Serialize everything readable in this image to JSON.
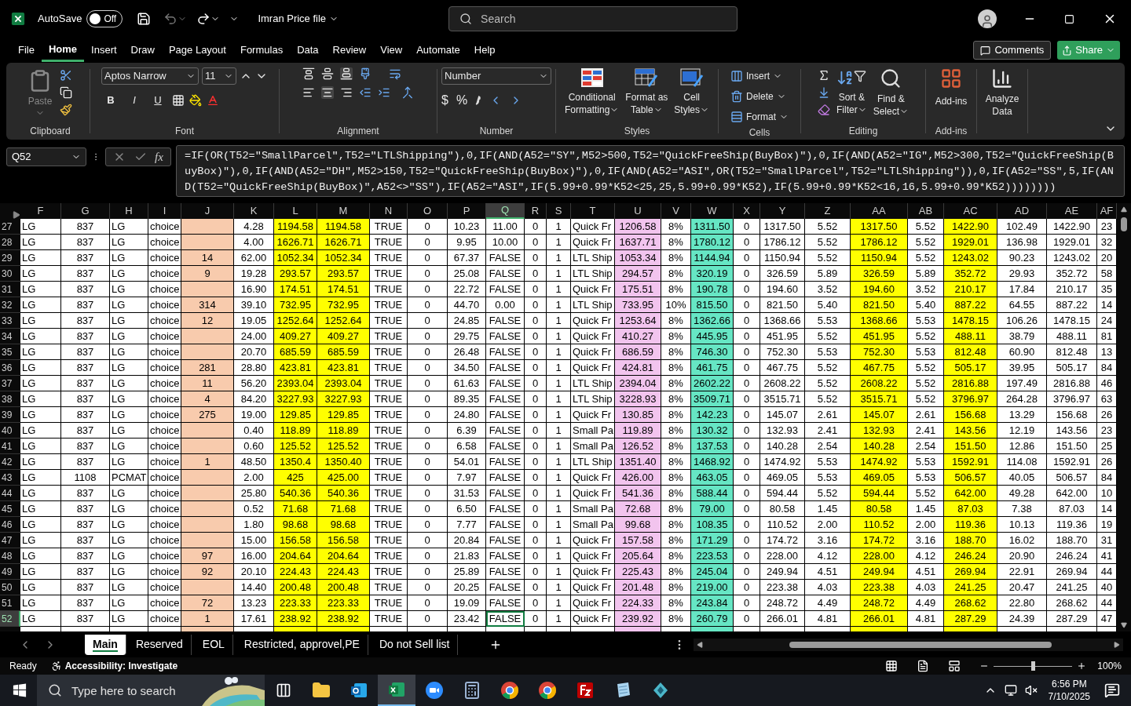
{
  "title_bar": {
    "autosave_label": "AutoSave",
    "autosave": {
      "label": "Off",
      "on": false
    },
    "file_name": "Imran Price file",
    "search": {
      "placeholder": "Search"
    }
  },
  "menu_tabs": [
    {
      "label": "File",
      "selected": false
    },
    {
      "label": "Home",
      "selected": true
    },
    {
      "label": "Insert",
      "selected": false
    },
    {
      "label": "Draw",
      "selected": false
    },
    {
      "label": "Page Layout",
      "selected": false
    },
    {
      "label": "Formulas",
      "selected": false
    },
    {
      "label": "Data",
      "selected": false
    },
    {
      "label": "Review",
      "selected": false
    },
    {
      "label": "View",
      "selected": false
    },
    {
      "label": "Automate",
      "selected": false
    },
    {
      "label": "Help",
      "selected": false
    }
  ],
  "comments_button": "Comments",
  "share_button": "Share",
  "ribbon": {
    "clipboard": {
      "label": "Clipboard",
      "paste": "Paste"
    },
    "font": {
      "label": "Font",
      "font_name": "Aptos Narrow",
      "font_size": "11",
      "bold": "B",
      "italic": "I",
      "underline": "U"
    },
    "alignment": {
      "label": "Alignment"
    },
    "number": {
      "label": "Number",
      "format": "Number",
      "currency": "$",
      "percent": "%"
    },
    "styles": {
      "label": "Styles",
      "buttons": [
        {
          "line1": "Conditional",
          "line2": "Formatting",
          "kind": "conditional"
        },
        {
          "line1": "Format as",
          "line2": "Table",
          "kind": "table"
        },
        {
          "line1": "Cell",
          "line2": "Styles",
          "kind": "cellstyles"
        }
      ]
    },
    "cells": {
      "label": "Cells",
      "buttons": [
        {
          "label": "Insert",
          "kind": "insert"
        },
        {
          "label": "Delete",
          "kind": "delete"
        },
        {
          "label": "Format",
          "kind": "format"
        }
      ]
    },
    "editing": {
      "label": "Editing",
      "buttons": [
        {
          "line1": "Sort &",
          "line2": "Filter",
          "kind": "sort"
        },
        {
          "line1": "Find &",
          "line2": "Select",
          "kind": "find"
        }
      ]
    },
    "addins": {
      "label": "Add-ins",
      "button": "Add-ins"
    },
    "analyze": {
      "line1": "Analyze",
      "line2": "Data"
    }
  },
  "formula_bar": {
    "name_box": "Q52",
    "function_label": "fx",
    "formula": "=IF(OR(T52=\"SmallParcel\",T52=\"LTLShipping\"),0,IF(AND(A52=\"SY\",M52>500,T52=\"QuickFreeShip(BuyBox)\"),0,IF(AND(A52=\"IG\",M52>300,T52=\"QuickFreeShip(BuyBox)\"),0,IF(AND(A52=\"DH\",M52>150,T52=\"QuickFreeShip(BuyBox)\"),0,IF(AND(A52=\"ASI\",OR(T52=\"SmallParcel\",T52=\"LTLShipping\")),0,IF(A52=\"SS\",5,IF(AND(T52=\"QuickFreeShip(BuyBox)\",A52<>\"SS\"),IF(A52=\"ASI\",IF(5.99+0.99*K52<25,25,5.99+0.99*K52),IF(5.99+0.99*K52<16,16,5.99+0.99*K52))))))))"
  },
  "sheet": {
    "columns": [
      {
        "label": "F",
        "selected": false
      },
      {
        "label": "G",
        "selected": false
      },
      {
        "label": "H",
        "selected": false
      },
      {
        "label": "I",
        "selected": false
      },
      {
        "label": "J",
        "selected": false,
        "color": "#f8cbad"
      },
      {
        "label": "K",
        "selected": false
      },
      {
        "label": "L",
        "selected": false,
        "color": "#ffff00"
      },
      {
        "label": "M",
        "selected": false,
        "color": "#ffff00"
      },
      {
        "label": "N",
        "selected": false
      },
      {
        "label": "O",
        "selected": false
      },
      {
        "label": "P",
        "selected": false
      },
      {
        "label": "Q",
        "selected": true
      },
      {
        "label": "R",
        "selected": false
      },
      {
        "label": "S",
        "selected": false
      },
      {
        "label": "T",
        "selected": false
      },
      {
        "label": "U",
        "selected": false,
        "color": "#f2c4ee"
      },
      {
        "label": "V",
        "selected": false
      },
      {
        "label": "W",
        "selected": false,
        "color": "#66e6c4"
      },
      {
        "label": "X",
        "selected": false
      },
      {
        "label": "Y",
        "selected": false
      },
      {
        "label": "Z",
        "selected": false
      },
      {
        "label": "AA",
        "selected": false,
        "color": "#ffff00"
      },
      {
        "label": "AB",
        "selected": false
      },
      {
        "label": "AC",
        "selected": false,
        "color": "#ffff00"
      },
      {
        "label": "AD",
        "selected": false
      },
      {
        "label": "AE",
        "selected": false
      },
      {
        "label": "AF",
        "selected": false
      }
    ],
    "rows": [
      {
        "number": "27",
        "selected": false,
        "cells": [
          "LG",
          "837",
          "LG",
          "choice",
          null,
          "4.28",
          "1194.58",
          "1194.58",
          "TRUE",
          "0",
          "10.23",
          "11.00",
          "0",
          "1",
          "Quick Fr",
          "1206.58",
          "8%",
          "1311.50",
          "0",
          "1317.50",
          "5.52",
          "1317.50",
          "5.52",
          "1422.90",
          "102.49",
          "1422.90",
          "23"
        ]
      },
      {
        "number": "28",
        "selected": false,
        "cells": [
          "LG",
          "837",
          "LG",
          "choice",
          null,
          "4.00",
          "1626.71",
          "1626.71",
          "TRUE",
          "0",
          "9.95",
          "10.00",
          "0",
          "1",
          "Quick Fr",
          "1637.71",
          "8%",
          "1780.12",
          "0",
          "1786.12",
          "5.52",
          "1786.12",
          "5.52",
          "1929.01",
          "136.98",
          "1929.01",
          "32"
        ]
      },
      {
        "number": "29",
        "selected": false,
        "cells": [
          "LG",
          "837",
          "LG",
          "choice",
          "14",
          "62.00",
          "1052.34",
          "1052.34",
          "TRUE",
          "0",
          "67.37",
          "FALSE",
          "0",
          "1",
          "LTL Ship",
          "1053.34",
          "8%",
          "1144.94",
          "0",
          "1150.94",
          "5.52",
          "1150.94",
          "5.52",
          "1243.02",
          "90.23",
          "1243.02",
          "20"
        ]
      },
      {
        "number": "30",
        "selected": false,
        "cells": [
          "LG",
          "837",
          "LG",
          "choice",
          "9",
          "19.28",
          "293.57",
          "293.57",
          "TRUE",
          "0",
          "25.08",
          "FALSE",
          "0",
          "1",
          "LTL Ship",
          "294.57",
          "8%",
          "320.19",
          "0",
          "326.59",
          "5.89",
          "326.59",
          "5.89",
          "352.72",
          "29.93",
          "352.72",
          "58"
        ]
      },
      {
        "number": "31",
        "selected": false,
        "cells": [
          "LG",
          "837",
          "LG",
          "choice",
          null,
          "16.90",
          "174.51",
          "174.51",
          "TRUE",
          "0",
          "22.72",
          "FALSE",
          "0",
          "1",
          "Quick Fr",
          "175.51",
          "8%",
          "190.78",
          "0",
          "194.60",
          "3.52",
          "194.60",
          "3.52",
          "210.17",
          "17.84",
          "210.17",
          "35"
        ]
      },
      {
        "number": "32",
        "selected": false,
        "cells": [
          "LG",
          "837",
          "LG",
          "choice",
          "314",
          "39.10",
          "732.95",
          "732.95",
          "TRUE",
          "0",
          "44.70",
          "0.00",
          "0",
          "1",
          "LTL Ship",
          "733.95",
          "10%",
          "815.50",
          "0",
          "821.50",
          "5.40",
          "821.50",
          "5.40",
          "887.22",
          "64.55",
          "887.22",
          "14"
        ]
      },
      {
        "number": "33",
        "selected": false,
        "cells": [
          "LG",
          "837",
          "LG",
          "choice",
          "12",
          "19.05",
          "1252.64",
          "1252.64",
          "TRUE",
          "0",
          "24.85",
          "FALSE",
          "0",
          "1",
          "Quick Fr",
          "1253.64",
          "8%",
          "1362.66",
          "0",
          "1368.66",
          "5.53",
          "1368.66",
          "5.53",
          "1478.15",
          "106.26",
          "1478.15",
          "24"
        ]
      },
      {
        "number": "34",
        "selected": false,
        "cells": [
          "LG",
          "837",
          "LG",
          "choice",
          null,
          "24.00",
          "409.27",
          "409.27",
          "TRUE",
          "0",
          "29.75",
          "FALSE",
          "0",
          "1",
          "Quick Fr",
          "410.27",
          "8%",
          "445.95",
          "0",
          "451.95",
          "5.52",
          "451.95",
          "5.52",
          "488.11",
          "38.79",
          "488.11",
          "81"
        ]
      },
      {
        "number": "35",
        "selected": false,
        "cells": [
          "LG",
          "837",
          "LG",
          "choice",
          null,
          "20.70",
          "685.59",
          "685.59",
          "TRUE",
          "0",
          "26.48",
          "FALSE",
          "0",
          "1",
          "Quick Fr",
          "686.59",
          "8%",
          "746.30",
          "0",
          "752.30",
          "5.53",
          "752.30",
          "5.53",
          "812.48",
          "60.90",
          "812.48",
          "13"
        ]
      },
      {
        "number": "36",
        "selected": false,
        "cells": [
          "LG",
          "837",
          "LG",
          "choice",
          "281",
          "28.80",
          "423.81",
          "423.81",
          "TRUE",
          "0",
          "34.50",
          "FALSE",
          "0",
          "1",
          "Quick Fr",
          "424.81",
          "8%",
          "461.75",
          "0",
          "467.75",
          "5.52",
          "467.75",
          "5.52",
          "505.17",
          "39.95",
          "505.17",
          "84"
        ]
      },
      {
        "number": "37",
        "selected": false,
        "cells": [
          "LG",
          "837",
          "LG",
          "choice",
          "11",
          "56.20",
          "2393.04",
          "2393.04",
          "TRUE",
          "0",
          "61.63",
          "FALSE",
          "0",
          "1",
          "LTL Ship",
          "2394.04",
          "8%",
          "2602.22",
          "0",
          "2608.22",
          "5.52",
          "2608.22",
          "5.52",
          "2816.88",
          "197.49",
          "2816.88",
          "46"
        ]
      },
      {
        "number": "38",
        "selected": false,
        "cells": [
          "LG",
          "837",
          "LG",
          "choice",
          "4",
          "84.20",
          "3227.93",
          "3227.93",
          "TRUE",
          "0",
          "89.35",
          "FALSE",
          "0",
          "1",
          "LTL Ship",
          "3228.93",
          "8%",
          "3509.71",
          "0",
          "3515.71",
          "5.52",
          "3515.71",
          "5.52",
          "3796.97",
          "264.28",
          "3796.97",
          "63"
        ]
      },
      {
        "number": "39",
        "selected": false,
        "cells": [
          "LG",
          "837",
          "LG",
          "choice",
          "275",
          "19.00",
          "129.85",
          "129.85",
          "TRUE",
          "0",
          "24.80",
          "FALSE",
          "0",
          "1",
          "Quick Fr",
          "130.85",
          "8%",
          "142.23",
          "0",
          "145.07",
          "2.61",
          "145.07",
          "2.61",
          "156.68",
          "13.29",
          "156.68",
          "26"
        ]
      },
      {
        "number": "40",
        "selected": false,
        "cells": [
          "LG",
          "837",
          "LG",
          "choice",
          null,
          "0.40",
          "118.89",
          "118.89",
          "TRUE",
          "0",
          "6.39",
          "FALSE",
          "0",
          "1",
          "Small Pa",
          "119.89",
          "8%",
          "130.32",
          "0",
          "132.93",
          "2.41",
          "132.93",
          "2.41",
          "143.56",
          "12.19",
          "143.56",
          "23"
        ]
      },
      {
        "number": "41",
        "selected": false,
        "cells": [
          "LG",
          "837",
          "LG",
          "choice",
          null,
          "0.60",
          "125.52",
          "125.52",
          "TRUE",
          "0",
          "6.58",
          "FALSE",
          "0",
          "1",
          "Small Pa",
          "126.52",
          "8%",
          "137.53",
          "0",
          "140.28",
          "2.54",
          "140.28",
          "2.54",
          "151.50",
          "12.86",
          "151.50",
          "25"
        ]
      },
      {
        "number": "42",
        "selected": false,
        "cells": [
          "LG",
          "837",
          "LG",
          "choice",
          "1",
          "48.50",
          "1350.4",
          "1350.40",
          "TRUE",
          "0",
          "54.01",
          "FALSE",
          "0",
          "1",
          "LTL Ship",
          "1351.40",
          "8%",
          "1468.92",
          "0",
          "1474.92",
          "5.53",
          "1474.92",
          "5.53",
          "1592.91",
          "114.08",
          "1592.91",
          "26"
        ]
      },
      {
        "number": "43",
        "selected": false,
        "cells": [
          "LG",
          "1108",
          "PCMAT",
          "choice",
          null,
          "2.00",
          "425",
          "425.00",
          "TRUE",
          "0",
          "7.97",
          "FALSE",
          "0",
          "1",
          "Quick Fr",
          "426.00",
          "8%",
          "463.05",
          "0",
          "469.05",
          "5.53",
          "469.05",
          "5.53",
          "506.57",
          "40.05",
          "506.57",
          "84"
        ]
      },
      {
        "number": "44",
        "selected": false,
        "cells": [
          "LG",
          "837",
          "LG",
          "choice",
          null,
          "25.80",
          "540.36",
          "540.36",
          "TRUE",
          "0",
          "31.53",
          "FALSE",
          "0",
          "1",
          "Quick Fr",
          "541.36",
          "8%",
          "588.44",
          "0",
          "594.44",
          "5.52",
          "594.44",
          "5.52",
          "642.00",
          "49.28",
          "642.00",
          "10"
        ]
      },
      {
        "number": "45",
        "selected": false,
        "cells": [
          "LG",
          "837",
          "LG",
          "choice",
          null,
          "0.52",
          "71.68",
          "71.68",
          "TRUE",
          "0",
          "6.50",
          "FALSE",
          "0",
          "1",
          "Small Pa",
          "72.68",
          "8%",
          "79.00",
          "0",
          "80.58",
          "1.45",
          "80.58",
          "1.45",
          "87.03",
          "7.38",
          "87.03",
          "14"
        ]
      },
      {
        "number": "46",
        "selected": false,
        "cells": [
          "LG",
          "837",
          "LG",
          "choice",
          null,
          "1.80",
          "98.68",
          "98.68",
          "TRUE",
          "0",
          "7.77",
          "FALSE",
          "0",
          "1",
          "Small Pa",
          "99.68",
          "8%",
          "108.35",
          "0",
          "110.52",
          "2.00",
          "110.52",
          "2.00",
          "119.36",
          "10.13",
          "119.36",
          "19"
        ]
      },
      {
        "number": "47",
        "selected": false,
        "cells": [
          "LG",
          "837",
          "LG",
          "choice",
          null,
          "15.00",
          "156.58",
          "156.58",
          "TRUE",
          "0",
          "20.84",
          "FALSE",
          "0",
          "1",
          "Quick Fr",
          "157.58",
          "8%",
          "171.29",
          "0",
          "174.72",
          "3.16",
          "174.72",
          "3.16",
          "188.70",
          "16.02",
          "188.70",
          "31"
        ]
      },
      {
        "number": "48",
        "selected": false,
        "cells": [
          "LG",
          "837",
          "LG",
          "choice",
          "97",
          "16.00",
          "204.64",
          "204.64",
          "TRUE",
          "0",
          "21.83",
          "FALSE",
          "0",
          "1",
          "Quick Fr",
          "205.64",
          "8%",
          "223.53",
          "0",
          "228.00",
          "4.12",
          "228.00",
          "4.12",
          "246.24",
          "20.90",
          "246.24",
          "41"
        ]
      },
      {
        "number": "49",
        "selected": false,
        "cells": [
          "LG",
          "837",
          "LG",
          "choice",
          "92",
          "20.10",
          "224.43",
          "224.43",
          "TRUE",
          "0",
          "25.89",
          "FALSE",
          "0",
          "1",
          "Quick Fr",
          "225.43",
          "8%",
          "245.04",
          "0",
          "249.94",
          "4.51",
          "249.94",
          "4.51",
          "269.94",
          "22.91",
          "269.94",
          "44"
        ]
      },
      {
        "number": "50",
        "selected": false,
        "cells": [
          "LG",
          "837",
          "LG",
          "choice",
          null,
          "14.40",
          "200.48",
          "200.48",
          "TRUE",
          "0",
          "20.25",
          "FALSE",
          "0",
          "1",
          "Quick Fr",
          "201.48",
          "8%",
          "219.00",
          "0",
          "223.38",
          "4.03",
          "223.38",
          "4.03",
          "241.25",
          "20.47",
          "241.25",
          "40"
        ]
      },
      {
        "number": "51",
        "selected": false,
        "cells": [
          "LG",
          "837",
          "LG",
          "choice",
          "72",
          "13.23",
          "223.33",
          "223.33",
          "TRUE",
          "0",
          "19.09",
          "FALSE",
          "0",
          "1",
          "Quick Fr",
          "224.33",
          "8%",
          "243.84",
          "0",
          "248.72",
          "4.49",
          "248.72",
          "4.49",
          "268.62",
          "22.80",
          "268.62",
          "44"
        ]
      },
      {
        "number": "52",
        "selected": true,
        "cells": [
          "LG",
          "837",
          "LG",
          "choice",
          "1",
          "17.61",
          "238.92",
          "238.92",
          "TRUE",
          "0",
          "23.42",
          "FALSE",
          "0",
          "1",
          "Quick Fr",
          "239.92",
          "8%",
          "260.79",
          "0",
          "266.01",
          "4.81",
          "266.01",
          "4.81",
          "287.29",
          "24.39",
          "287.29",
          "47"
        ]
      }
    ]
  },
  "sheet_tabs": [
    {
      "label": "Main",
      "selected": true
    },
    {
      "label": "Reserved",
      "selected": false
    },
    {
      "label": "EOL",
      "selected": false
    },
    {
      "label": "Restricted, approvel,PE",
      "selected": false
    },
    {
      "label": "Do not Sell list",
      "selected": false
    }
  ],
  "status_bar": {
    "ready": "Ready",
    "accessibility": "Accessibility: Investigate",
    "zoom": {
      "label": "100%",
      "level": 0.5
    }
  },
  "taskbar": {
    "search_placeholder": "Type here to search",
    "apps": [
      {
        "kind": "taskview",
        "selected": false
      },
      {
        "kind": "explorer",
        "selected": false
      },
      {
        "kind": "outlook",
        "selected": false
      },
      {
        "kind": "excel",
        "selected": true
      },
      {
        "kind": "zoom",
        "selected": false
      },
      {
        "kind": "calculator",
        "selected": false
      },
      {
        "kind": "chrome",
        "selected": false
      },
      {
        "kind": "chrome",
        "selected": false
      },
      {
        "kind": "filezilla",
        "selected": false
      },
      {
        "kind": "notepad",
        "selected": false
      },
      {
        "kind": "diamond",
        "selected": false
      }
    ],
    "time": "6:56 PM",
    "date": "7/10/2025"
  }
}
